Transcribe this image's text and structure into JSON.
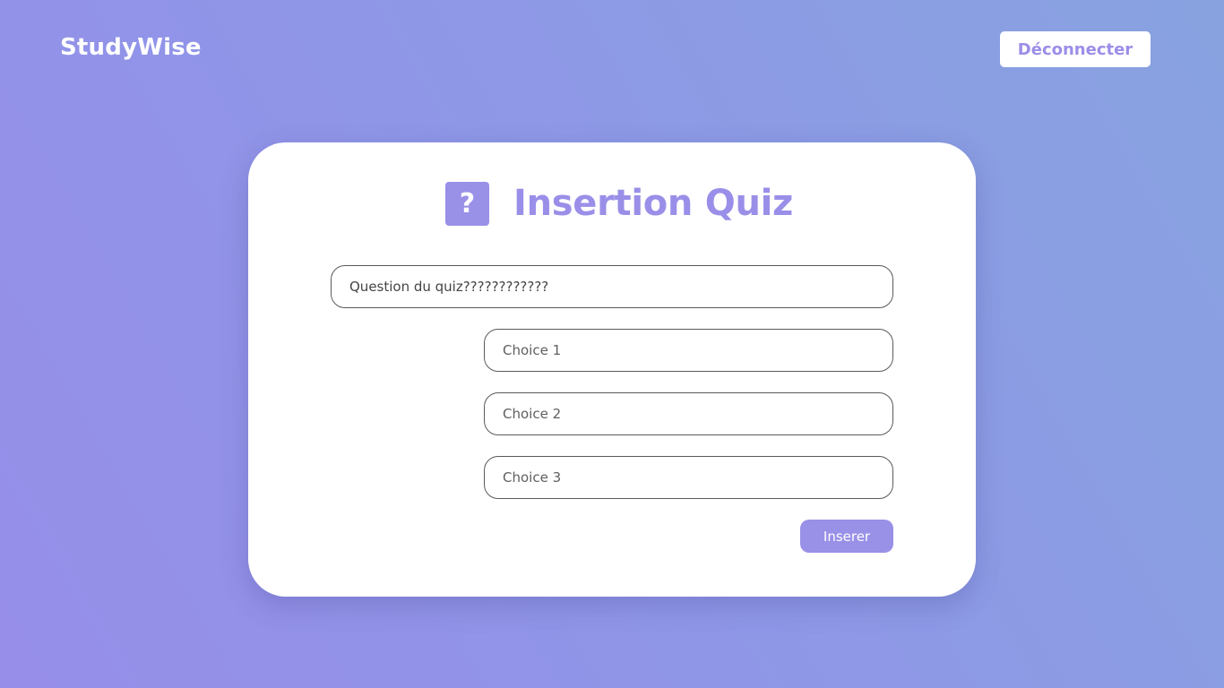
{
  "header": {
    "brand": "StudyWise",
    "logout_label": "Déconnecter"
  },
  "card": {
    "icon": "question-icon",
    "icon_glyph": "?",
    "title": "Insertion Quiz",
    "question": {
      "value": "Question du quiz????????????",
      "placeholder": ""
    },
    "choices": [
      {
        "value": "",
        "placeholder": "Choice 1"
      },
      {
        "value": "",
        "placeholder": "Choice 2"
      },
      {
        "value": "",
        "placeholder": "Choice 3"
      }
    ],
    "submit_label": "Inserer"
  },
  "colors": {
    "accent": "#9990e8",
    "background_start": "#968ee9",
    "background_end": "#88a2e0",
    "card": "#ffffff"
  }
}
